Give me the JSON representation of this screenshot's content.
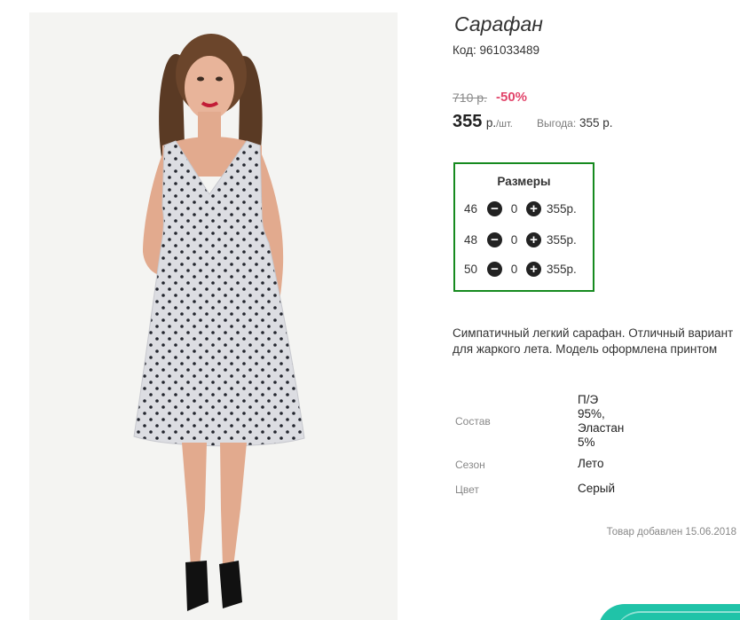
{
  "product": {
    "title": "Сарафан",
    "code_label": "Код:",
    "code_value": "961033489",
    "old_price": "710 р.",
    "discount": "-50%",
    "price": "355",
    "price_unit": "р.",
    "price_unit_sub": "/шт.",
    "benefit_label": "Выгода:",
    "benefit_value": "355 р."
  },
  "sizes": {
    "title": "Размеры",
    "rows": [
      {
        "size": "46",
        "qty": "0",
        "price": "355р."
      },
      {
        "size": "48",
        "qty": "0",
        "price": "355р."
      },
      {
        "size": "50",
        "qty": "0",
        "price": "355р."
      }
    ],
    "minus_icon": "minus-circle-icon",
    "plus_icon": "plus-circle-icon"
  },
  "description": "Симпатичный легкий сарафан. Отличный вариант для жаркого лета. Модель оформлена принтом",
  "attributes": [
    {
      "label": "Состав",
      "value_lines": [
        "П/Э",
        "95%,",
        "Эластан",
        "5%"
      ]
    },
    {
      "label": "Сезон",
      "value_lines": [
        "Лето"
      ]
    },
    {
      "label": "Цвет",
      "value_lines": [
        "Серый"
      ]
    }
  ],
  "added_text": "Товар добавлен 15.06.2018",
  "colors": {
    "discount": "#e2456b",
    "sizes_border": "#168a1f",
    "teal_tab": "#20c3a8"
  }
}
